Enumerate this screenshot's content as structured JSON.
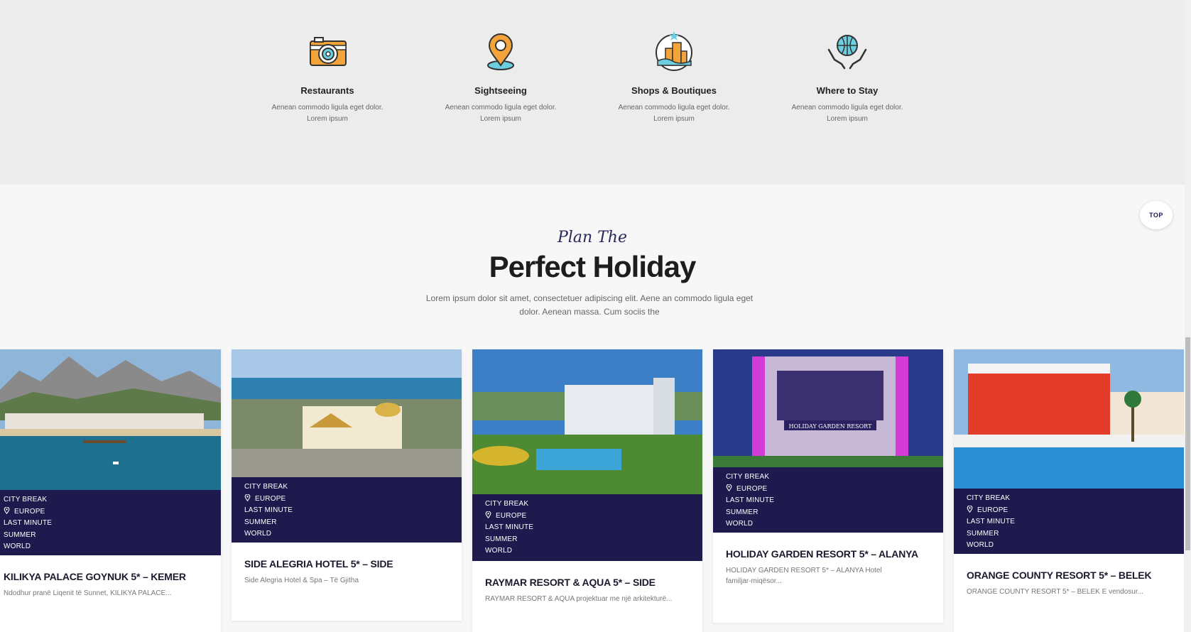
{
  "features": [
    {
      "icon": "camera-icon",
      "title": "Restaurants",
      "desc_line1": "Aenean commodo ligula eget dolor.",
      "desc_line2": "Lorem ipsum"
    },
    {
      "icon": "map-pin-icon",
      "title": "Sightseeing",
      "desc_line1": "Aenean commodo ligula eget dolor.",
      "desc_line2": "Lorem ipsum"
    },
    {
      "icon": "city-icon",
      "title": "Shops & Boutiques",
      "desc_line1": "Aenean commodo ligula eget dolor.",
      "desc_line2": "Lorem ipsum"
    },
    {
      "icon": "globe-hands-icon",
      "title": "Where to Stay",
      "desc_line1": "Aenean commodo ligula eget dolor.",
      "desc_line2": "Lorem ipsum"
    }
  ],
  "heading": {
    "script": "Plan The",
    "title": "Perfect Holiday",
    "lead": "Lorem ipsum dolor sit amet, consectetuer adipiscing elit. Aene an commodo ligula eget dolor. Aenean massa. Cum sociis the"
  },
  "top_button": "TOP",
  "colors": {
    "accent": "#1e1a4d",
    "band": "#ececec",
    "page": "#f7f7f7"
  },
  "cards": [
    {
      "tags": [
        "City Break",
        "Europe",
        "Last Minute",
        "Summer",
        "World"
      ],
      "title": "KILIKYA PALACE GOYNUK 5* – KEMER",
      "excerpt": "Ndodhur pranë Liqenit të Sunnet, KILIKYA PALACE..."
    },
    {
      "tags": [
        "City Break",
        "Europe",
        "Last Minute",
        "Summer",
        "World"
      ],
      "title": "SIDE ALEGRIA HOTEL 5* – SIDE",
      "excerpt": "Side Alegria Hotel & Spa – Të Gjitha"
    },
    {
      "tags": [
        "City Break",
        "Europe",
        "Last Minute",
        "Summer",
        "World"
      ],
      "title": "RAYMAR RESORT & AQUA 5* – SIDE",
      "excerpt": "RAYMAR RESORT & AQUA projektuar me një arkitekturë..."
    },
    {
      "tags": [
        "City Break",
        "Europe",
        "Last Minute",
        "Summer",
        "World"
      ],
      "title": "HOLIDAY GARDEN RESORT 5* – ALANYA",
      "excerpt": "HOLIDAY GARDEN RESORT 5* – ALANYA Hotel familjar-miqësor...",
      "sign": "HOLIDAY GARDEN RESORT"
    },
    {
      "tags": [
        "City Break",
        "Europe",
        "Last Minute",
        "Summer",
        "World"
      ],
      "title": "ORANGE COUNTY RESORT 5* – BELEK",
      "excerpt": "ORANGE COUNTY RESORT 5* – BELEK E vendosur..."
    }
  ]
}
